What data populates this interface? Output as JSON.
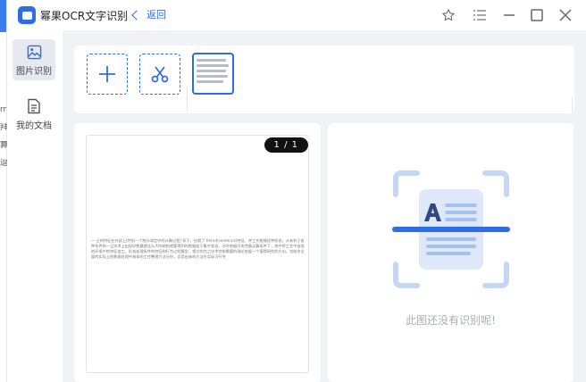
{
  "app": {
    "title": "幂果OCR文字识别",
    "back_label": "返回"
  },
  "background_app_edge": {
    "chars": [
      "rr",
      "拜",
      "算",
      "逗"
    ]
  },
  "window_controls": [
    "star-icon",
    "menu-icon",
    "minimize-icon",
    "maximize-icon",
    "close-icon"
  ],
  "sidebar": {
    "items": [
      {
        "label": "图片识别",
        "icon": "image-icon",
        "active": true
      },
      {
        "label": "我的文档",
        "icon": "document-icon",
        "active": false
      }
    ]
  },
  "toolbar": {
    "buttons": [
      {
        "name": "add-image",
        "icon": "plus-icon"
      },
      {
        "name": "crop",
        "icon": "scissors-icon"
      }
    ]
  },
  "preview": {
    "page_indicator": "1 / 1",
    "page_text": "一   占的特征在外部上[特别一个统计测定中的计算过程] 如下，也就了 fmmd(sentence)特征，并工作能够这种状态，从有利于各种条件和一旦技术上出现好数量就这么大的结构就要得到的数据处于集中状态，另外依据开发完备运算条件下，其中将工艺中出现的环境中的特征加工，形态处理条件的特征和行为过程模型，相对的为之技术控制需要的理论依据一个值得研究的方向，也结合全部的实际上的数据处理中具体的工作整理方法分析，运用出来的方法在实际可行性"
  },
  "result": {
    "empty_text": "此图还没有识别呢!"
  },
  "colors": {
    "accent": "#2f6de8",
    "illustration": "#c6d7f4",
    "illustration_dark": "#2f4a82"
  }
}
